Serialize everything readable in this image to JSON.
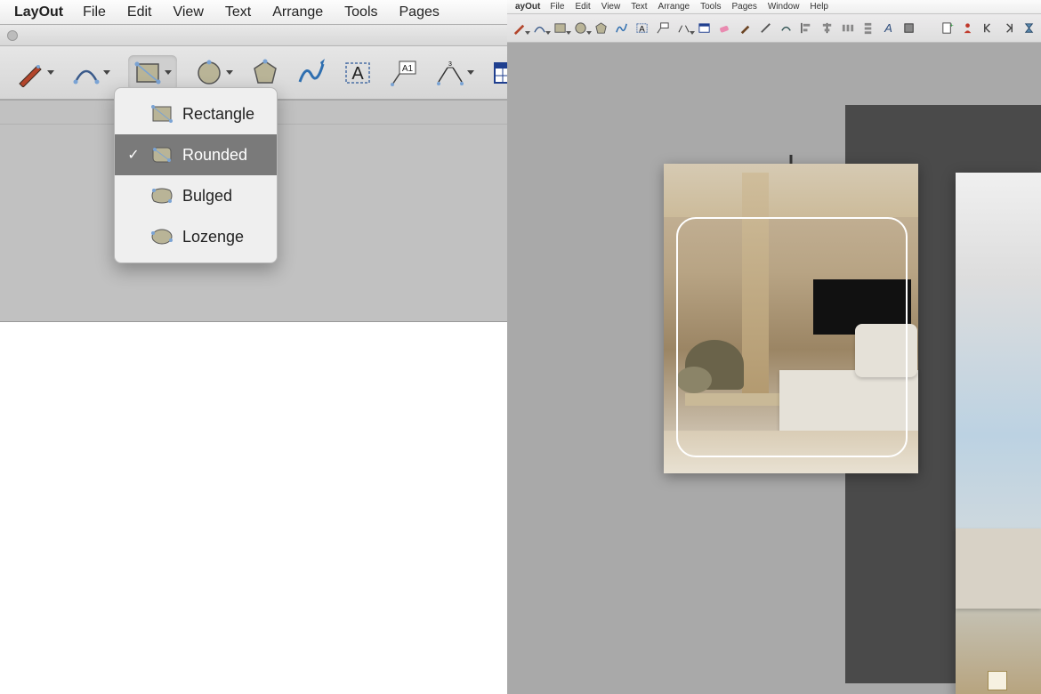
{
  "left": {
    "app_name": "LayOut",
    "menu": [
      "File",
      "Edit",
      "View",
      "Text",
      "Arrange",
      "Tools",
      "Pages"
    ],
    "dropdown": {
      "items": [
        {
          "label": "Rectangle",
          "icon": "rectangle"
        },
        {
          "label": "Rounded",
          "icon": "rounded"
        },
        {
          "label": "Bulged",
          "icon": "bulged"
        },
        {
          "label": "Lozenge",
          "icon": "lozenge"
        }
      ],
      "selected_index": 1
    }
  },
  "right": {
    "app_name": "ayOut",
    "menu": [
      "File",
      "Edit",
      "View",
      "Text",
      "Arrange",
      "Tools",
      "Pages",
      "Window",
      "Help"
    ]
  }
}
